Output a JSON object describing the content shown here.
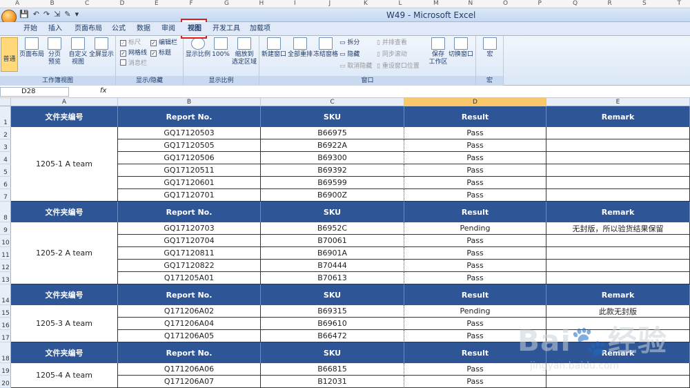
{
  "window": {
    "title": "W49 - Microsoft Excel"
  },
  "top_ruler_letters": [
    "A",
    "B",
    "C",
    "D",
    "E",
    "F",
    "G",
    "H",
    "I",
    "J",
    "K",
    "L",
    "M",
    "N",
    "O",
    "P",
    "Q",
    "R",
    "S",
    "T"
  ],
  "quick_access": [
    "💾",
    "↶",
    "↷",
    "⇲",
    "✎",
    "▾"
  ],
  "tabs": [
    "开始",
    "插入",
    "页面布局",
    "公式",
    "数据",
    "审阅",
    "视图",
    "开发工具",
    "加载项"
  ],
  "active_tab": "视图",
  "ribbon": {
    "workbook_views": {
      "label": "工作簿视图",
      "buttons": [
        "普通",
        "页面布局",
        "分页\n预览",
        "自定义\n视图",
        "全屏显示"
      ]
    },
    "show_hide": {
      "label": "显示/隐藏",
      "items": [
        {
          "text": "标尺",
          "checked": true,
          "disabled": true
        },
        {
          "text": "编辑栏",
          "checked": true,
          "disabled": false
        },
        {
          "text": "网格线",
          "checked": true,
          "disabled": false
        },
        {
          "text": "标题",
          "checked": true,
          "disabled": false
        },
        {
          "text": "消息栏",
          "checked": false,
          "disabled": true
        }
      ]
    },
    "zoom": {
      "label": "显示比例",
      "buttons": [
        "显示比例",
        "100%",
        "缩放到\n选定区域"
      ]
    },
    "window_group": {
      "label": "窗口",
      "buttons": [
        "新建窗口",
        "全部重排",
        "冻结窗格"
      ],
      "small": [
        "拆分",
        "隐藏",
        "取消隐藏"
      ],
      "small2": [
        "并排查看",
        "同步滚动",
        "重设窗口位置"
      ],
      "buttons2": [
        "保存\n工作区",
        "切换窗口"
      ]
    },
    "macro": {
      "label": "宏",
      "button": "宏"
    }
  },
  "formula_bar": {
    "name_box": "D28",
    "fx": "fx"
  },
  "columns": [
    {
      "letter": "A",
      "header": "文件夹编号"
    },
    {
      "letter": "B",
      "header": "Report No."
    },
    {
      "letter": "C",
      "header": "SKU"
    },
    {
      "letter": "D",
      "header": "Result"
    },
    {
      "letter": "E",
      "header": "Remark"
    }
  ],
  "row_numbers": [
    "1",
    "2",
    "3",
    "4",
    "5",
    "6",
    "7",
    "8",
    "9",
    "10",
    "11",
    "12",
    "13",
    "14",
    "15",
    "16",
    "17",
    "18",
    "19",
    "20"
  ],
  "groups": [
    {
      "team": "1205-1 A team",
      "rows": [
        [
          "GQ17120503",
          "B66975",
          "Pass",
          ""
        ],
        [
          "GQ17120505",
          "B6922A",
          "Pass",
          ""
        ],
        [
          "GQ17120506",
          "B69300",
          "Pass",
          ""
        ],
        [
          "GQ17120511",
          "B69392",
          "Pass",
          ""
        ],
        [
          "GQ17120601",
          "B69599",
          "Pass",
          ""
        ],
        [
          "GQ17120701",
          "B6900Z",
          "Pass",
          ""
        ]
      ]
    },
    {
      "team": "1205-2 A team",
      "rows": [
        [
          "GQ17120703",
          "B6952C",
          "Pending",
          "无封版，所以验货结果保留"
        ],
        [
          "GQ17120704",
          "B70061",
          "Pass",
          ""
        ],
        [
          "GQ17120811",
          "B6901A",
          "Pass",
          ""
        ],
        [
          "GQ17120822",
          "B70444",
          "Pass",
          ""
        ],
        [
          "Q171205A01",
          "B70613",
          "Pass",
          ""
        ]
      ]
    },
    {
      "team": "1205-3 A team",
      "rows": [
        [
          "Q171206A02",
          "B69315",
          "Pending",
          "此款无封版"
        ],
        [
          "Q171206A04",
          "B69610",
          "Pass",
          ""
        ],
        [
          "Q171206A05",
          "B66472",
          "Pass",
          ""
        ]
      ]
    },
    {
      "team": "1205-4 A team",
      "rows": [
        [
          "Q171206A06",
          "B66815",
          "Pass",
          ""
        ],
        [
          "Q171206A07",
          "B12031",
          "Pass",
          ""
        ]
      ]
    }
  ],
  "watermark": {
    "main": "Bai🐾经验",
    "sub": "jingyan.baidu.com"
  },
  "colors": {
    "header_bg": "#2e5596",
    "highlight": "#e31b1b",
    "active_col": "#f8c86a"
  }
}
